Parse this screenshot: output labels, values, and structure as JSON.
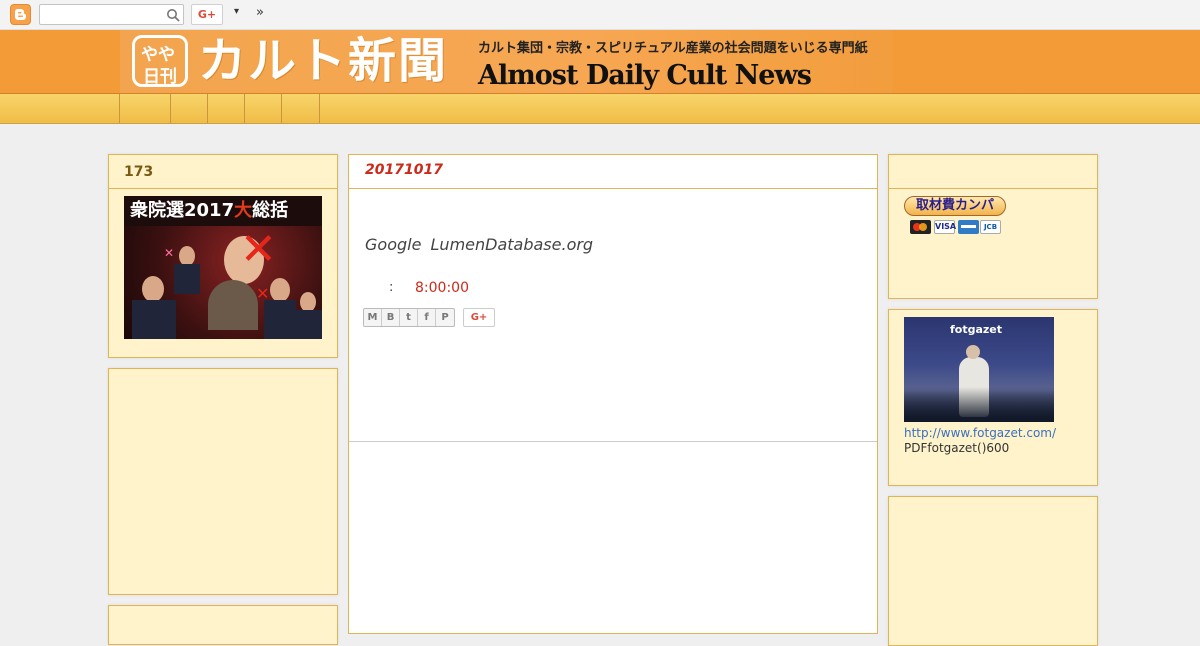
{
  "navbar": {
    "logo_icon": "blogger-icon",
    "search_placeholder": "",
    "gplus_label": "G+",
    "more_label": "▾",
    "overflow_label": "»"
  },
  "header": {
    "badge_line1": "やや",
    "badge_line2": "日刊",
    "title": "カルト新聞",
    "subtitle": "カルト集団・宗教・スピリチュアル産業の社会問題をいじる専門紙",
    "english_title": "Almost Daily Cult News"
  },
  "tabs": [
    "",
    "",
    "",
    "",
    ""
  ],
  "left_sidebar": {
    "widget1_title": "173",
    "election_banner_prefix": "衆院選2017",
    "election_banner_big": "大",
    "election_banner_suffix": "総括"
  },
  "post": {
    "date": "20171017",
    "body": "Google LumenDatabase.org",
    "time_label": ":",
    "time": "8:00:00",
    "share_icons": [
      "M",
      "B",
      "t",
      "f",
      "P"
    ],
    "gplus_label": "G+"
  },
  "right_sidebar": {
    "kanpa_label": "取材費カンパ",
    "card_icons": [
      "mastercard-icon",
      "visa-icon",
      "amex-icon",
      "jcb-icon"
    ],
    "card_visa_label": "VISA",
    "card_jcb_label": "JCB",
    "fotgazet_logo": "fotgazet",
    "fotgazet_link": "http://www.fotgazet.com/",
    "fotgazet_text": "PDFfotgazet()600"
  },
  "colors": {
    "header_bg": "#f29b37",
    "tab_bg": "#f8d46b",
    "widget_bg": "#fff3cc",
    "widget_border": "#e2b45a",
    "accent_red": "#cc2a1a"
  }
}
